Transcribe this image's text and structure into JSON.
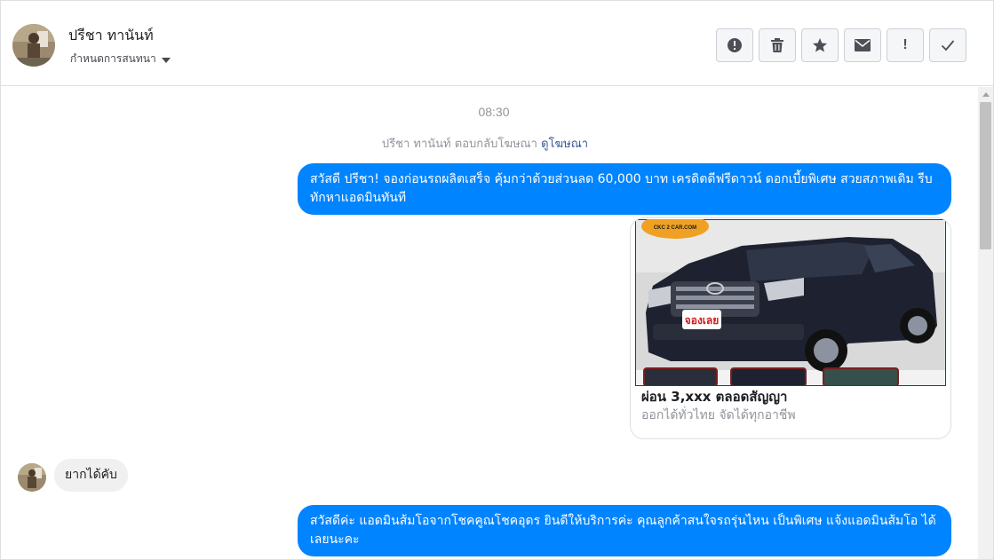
{
  "header": {
    "contact_name": "ปรีชา ทานันท์",
    "assign_label": "กำหนดการสนทนา",
    "actions": [
      {
        "name": "spam-button",
        "icon": "alert-circle-icon"
      },
      {
        "name": "delete-button",
        "icon": "trash-icon"
      },
      {
        "name": "star-button",
        "icon": "star-icon"
      },
      {
        "name": "mark-unread-button",
        "icon": "envelope-icon"
      },
      {
        "name": "follow-up-button",
        "icon": "exclamation-icon"
      },
      {
        "name": "mark-done-button",
        "icon": "check-icon"
      }
    ]
  },
  "conversation": {
    "timestamp": "08:30",
    "replied_prefix": "ปรีชา ทานันท์ ตอบกลับโฆษณา",
    "replied_link": "ดูโฆษณา",
    "messages": [
      {
        "from": "page",
        "text": "สวัสดี ปรีชา! จองก่อนรถผลิตเสร็จ คุ้มกว่าด้วยส่วนลด 60,000 บาท เครดิตดีฟรีดาวน์ ดอกเบี้ยพิเศษ สวยสภาพเดิม รีบทักหาแอดมินทันที"
      },
      {
        "from": "page",
        "type": "ad_card",
        "title": "ผ่อน 3,xxx ตลอดสัญญา",
        "subtitle": "ออกได้ทั่วไทย จัดได้ทุกอาชีพ",
        "image_badge": "จองเลย",
        "image_logo": "CKC 2 CAR.COM"
      },
      {
        "from": "customer",
        "text": "ยากได้คับ"
      },
      {
        "from": "page",
        "text": "สวัสดีค่ะ แอดมินส้มโอจากโชคคูณโชคอุดร ยินดีให้บริการค่ะ  คุณลูกค้าสนใจรถรุ่นไหน เป็นพิเศษ แจ้งแอดมินส้มโอ ได้เลยนะคะ"
      }
    ]
  },
  "colors": {
    "accent": "#0084ff",
    "incoming_bubble": "#f1f0f0",
    "link": "#365899"
  }
}
